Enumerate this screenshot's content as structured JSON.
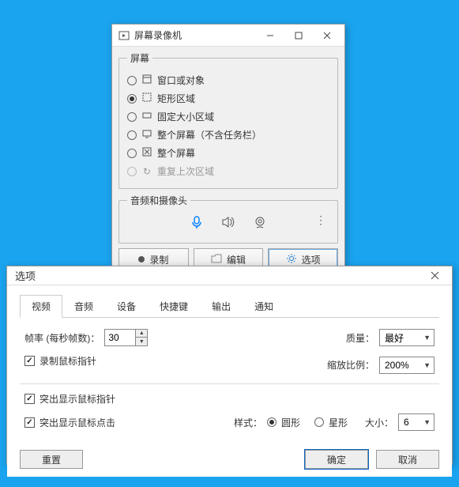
{
  "recorder": {
    "title": "屏幕录像机",
    "screen_group": "屏幕",
    "modes": [
      {
        "label": "窗口或对象",
        "selected": false,
        "disabled": false
      },
      {
        "label": "矩形区域",
        "selected": true,
        "disabled": false
      },
      {
        "label": "固定大小区域",
        "selected": false,
        "disabled": false
      },
      {
        "label": "整个屏幕（不含任务栏）",
        "selected": false,
        "disabled": false
      },
      {
        "label": "整个屏幕",
        "selected": false,
        "disabled": false
      },
      {
        "label": "重复上次区域",
        "selected": false,
        "disabled": true
      }
    ],
    "av_group": "音频和摄像头",
    "buttons": {
      "record": "录制",
      "edit": "编辑",
      "options": "选项"
    }
  },
  "options": {
    "title": "选项",
    "tabs": [
      "视频",
      "音频",
      "设备",
      "快捷键",
      "输出",
      "通知"
    ],
    "active_tab": 0,
    "framerate_label": "帧率 (每秒帧数)：",
    "framerate_value": "30",
    "quality_label": "质量：",
    "quality_value": "最好",
    "zoom_label": "缩放比例：",
    "zoom_value": "200%",
    "cb_record_cursor": "录制鼠标指针",
    "cb_highlight_cursor": "突出显示鼠标指针",
    "cb_highlight_click": "突出显示鼠标点击",
    "style_label": "样式：",
    "style_circle": "圆形",
    "style_star": "星形",
    "size_label": "大小：",
    "size_value": "6",
    "reset": "重置",
    "ok": "确定",
    "cancel": "取消"
  }
}
